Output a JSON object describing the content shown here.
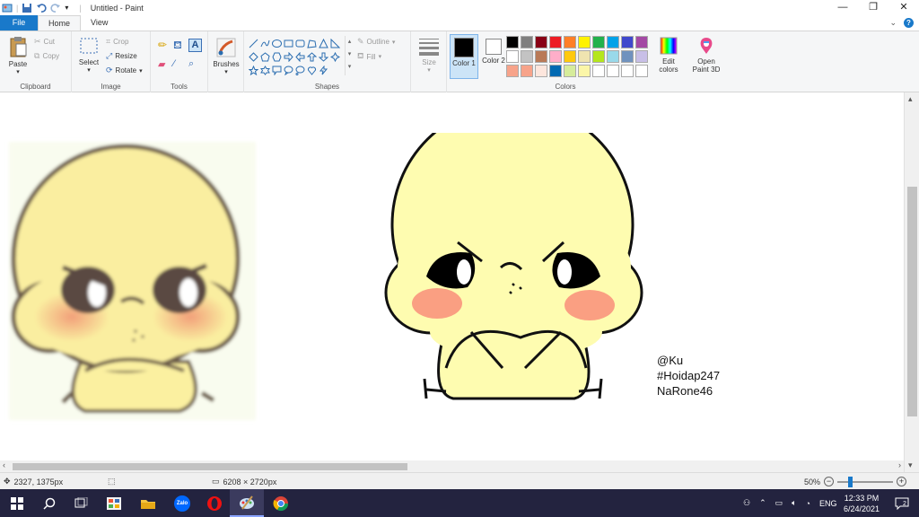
{
  "window": {
    "title": "Untitled - Paint"
  },
  "tabs": [
    "File",
    "Home",
    "View"
  ],
  "clipboard": {
    "paste": "Paste",
    "cut": "Cut",
    "copy": "Copy",
    "group": "Clipboard"
  },
  "image": {
    "select": "Select",
    "crop": "Crop",
    "resize": "Resize",
    "rotate": "Rotate",
    "group": "Image"
  },
  "tools": {
    "group": "Tools"
  },
  "brushes": {
    "label": "Brushes"
  },
  "shapes": {
    "outline": "Outline",
    "fill": "Fill",
    "group": "Shapes"
  },
  "size": {
    "label": "Size"
  },
  "colors": {
    "color1_label": "Color 1",
    "color2_label": "Color 2",
    "color1": "#000000",
    "color2": "#ffffff",
    "edit_label": "Edit colors",
    "group": "Colors",
    "palette": [
      "#000000",
      "#7f7f7f",
      "#880015",
      "#ed1c24",
      "#ff7f27",
      "#fff200",
      "#22b14c",
      "#00a2e8",
      "#3f48cc",
      "#a349a4",
      "#ffffff",
      "#c3c3c3",
      "#b97a57",
      "#ffaec9",
      "#ffc90e",
      "#efe4b0",
      "#b5e61d",
      "#99d9ea",
      "#7092be",
      "#c8bfe7",
      "#f7a38a",
      "#f7a38a",
      "#fde6dd",
      "#0069b2",
      "#d6ec9b",
      "#fbf6a8",
      "#ffffff",
      "#ffffff",
      "#ffffff",
      "#ffffff"
    ]
  },
  "paint3d": {
    "label": "Open Paint 3D"
  },
  "canvas": {
    "signature": [
      "@Ku",
      "#Hoidap247",
      "NaRone46"
    ]
  },
  "status": {
    "cursor_pos": "2327, 1375px",
    "image_size": "6208 × 2720px",
    "zoom": "50%"
  },
  "taskbar": {
    "time": "12:33 PM",
    "date": "6/24/2021",
    "lang": "ENG",
    "notif_count": "2",
    "zalo": "Zalo"
  }
}
